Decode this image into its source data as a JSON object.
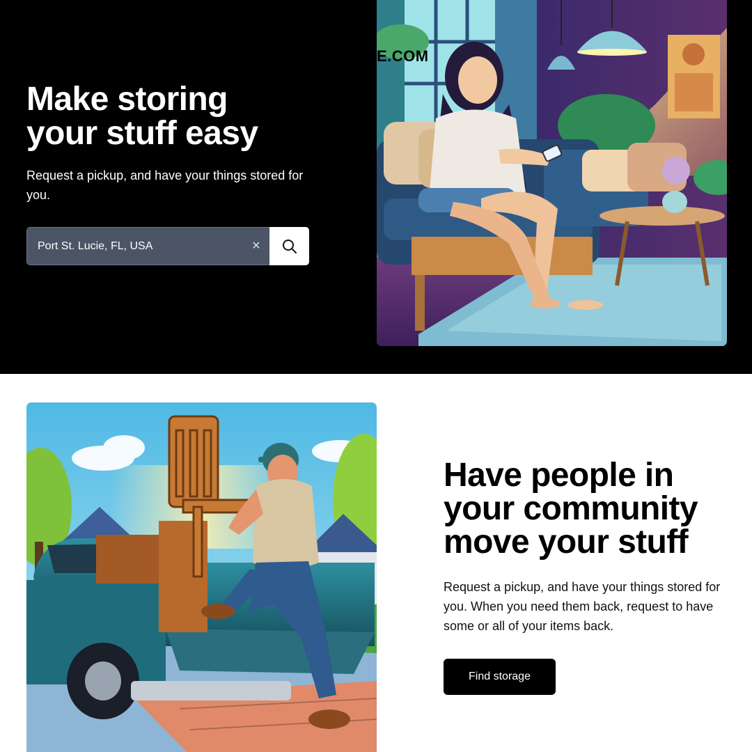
{
  "brand": {
    "overlay_text": "E.COM"
  },
  "hero": {
    "title_line_1": "Make storing",
    "title_line_2": "your stuff easy",
    "subtitle": "Request a pickup, and have your things stored for you.",
    "search": {
      "value": "Port St. Lucie, FL, USA",
      "clear_icon": "close-icon",
      "button_icon": "search-icon"
    }
  },
  "feature": {
    "title_line_1": "Have people in",
    "title_line_2": "your community",
    "title_line_3": "move your stuff",
    "description": "Request a pickup, and have your things stored for you. When you need them back, request to have some or all of your items back.",
    "button_label": "Find storage"
  },
  "colors": {
    "hero_background": "#000000",
    "search_field": "#4b5565",
    "primary_button": "#000000",
    "page_background": "#ffffff"
  }
}
